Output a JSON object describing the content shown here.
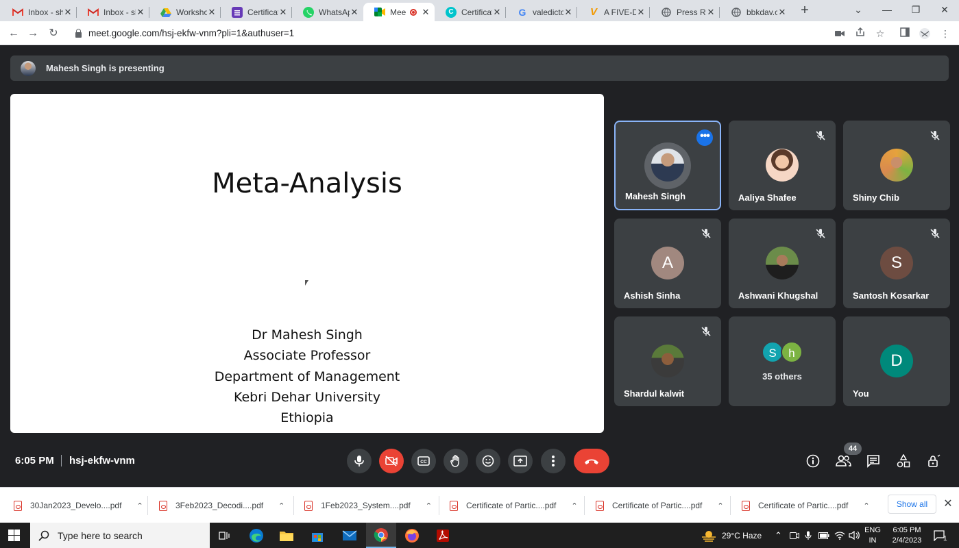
{
  "browser": {
    "tabs": [
      {
        "title": "Inbox - sh",
        "icon": "gmail-icon",
        "active": false
      },
      {
        "title": "Inbox - sh",
        "icon": "gmail-icon",
        "active": false
      },
      {
        "title": "Worksho",
        "icon": "google-drive-icon",
        "active": false
      },
      {
        "title": "Certificat",
        "icon": "google-forms-icon",
        "active": false
      },
      {
        "title": "WhatsAp",
        "icon": "whatsapp-icon",
        "active": false
      },
      {
        "title": "Meet",
        "icon": "google-meet-icon",
        "active": true
      },
      {
        "title": "Certificat",
        "icon": "canva-icon",
        "active": false
      },
      {
        "title": "valedicto",
        "icon": "google-icon",
        "active": false
      },
      {
        "title": "A FIVE-D",
        "icon": "v-logo-icon",
        "active": false
      },
      {
        "title": "Press Rel",
        "icon": "globe-icon",
        "active": false
      },
      {
        "title": "bbkdav.c",
        "icon": "globe-icon",
        "active": false
      }
    ],
    "url": "meet.google.com/hsj-ekfw-vnm?pli=1&authuser=1"
  },
  "meet": {
    "presenting_banner": "Mahesh Singh is presenting",
    "slide": {
      "title": "Meta-Analysis",
      "lines": [
        "Dr Mahesh Singh",
        "Associate Professor",
        "Department of Management",
        "Kebri Dehar University",
        "Ethiopia"
      ]
    },
    "participants": [
      {
        "name": "Mahesh Singh",
        "muted": false,
        "active": true,
        "avatar_type": "photo",
        "avatar_color": "#2d3a52"
      },
      {
        "name": "Aaliya Shafee",
        "muted": true,
        "active": false,
        "avatar_type": "photo",
        "avatar_color": "#f3c9b5"
      },
      {
        "name": "Shiny Chib",
        "muted": true,
        "active": false,
        "avatar_type": "photo",
        "avatar_color": "#d98a4f"
      },
      {
        "name": "Ashish Sinha",
        "muted": true,
        "active": false,
        "avatar_type": "letter",
        "letter": "A",
        "avatar_color": "#a1887f"
      },
      {
        "name": "Ashwani Khugshal",
        "muted": true,
        "active": false,
        "avatar_type": "photo",
        "avatar_color": "#4e6b3c"
      },
      {
        "name": "Santosh Kosarkar",
        "muted": true,
        "active": false,
        "avatar_type": "letter",
        "letter": "S",
        "avatar_color": "#6d4c41"
      },
      {
        "name": "Shardul kalwit",
        "muted": true,
        "active": false,
        "avatar_type": "photo",
        "avatar_color": "#5a7a3a"
      },
      {
        "name": "You",
        "muted": false,
        "active": false,
        "avatar_type": "letter",
        "letter": "D",
        "avatar_color": "#00897b"
      }
    ],
    "others": {
      "label": "35 others",
      "avatars": [
        {
          "letter": "S",
          "color": "#12a4af"
        },
        {
          "letter": "h",
          "color": "#7cb342"
        }
      ]
    },
    "time": "6:05 PM",
    "meeting_code": "hsj-ekfw-vnm",
    "participant_count": "44"
  },
  "downloads": {
    "items": [
      "30Jan2023_Develo....pdf",
      "3Feb2023_Decodi....pdf",
      "1Feb2023_System....pdf",
      "Certificate of Partic....pdf",
      "Certificate of Partic....pdf",
      "Certificate of Partic....pdf"
    ],
    "show_all": "Show all"
  },
  "taskbar": {
    "search_placeholder": "Type here to search",
    "weather": "29°C  Haze",
    "lang_top": "ENG",
    "lang_bottom": "IN",
    "time": "6:05 PM",
    "date": "2/4/2023",
    "notification_count": "1"
  },
  "colors": {
    "meet_bg": "#202124",
    "tile_bg": "#3c4043",
    "accent_blue": "#1a73e8",
    "hangup_red": "#ea4335"
  }
}
